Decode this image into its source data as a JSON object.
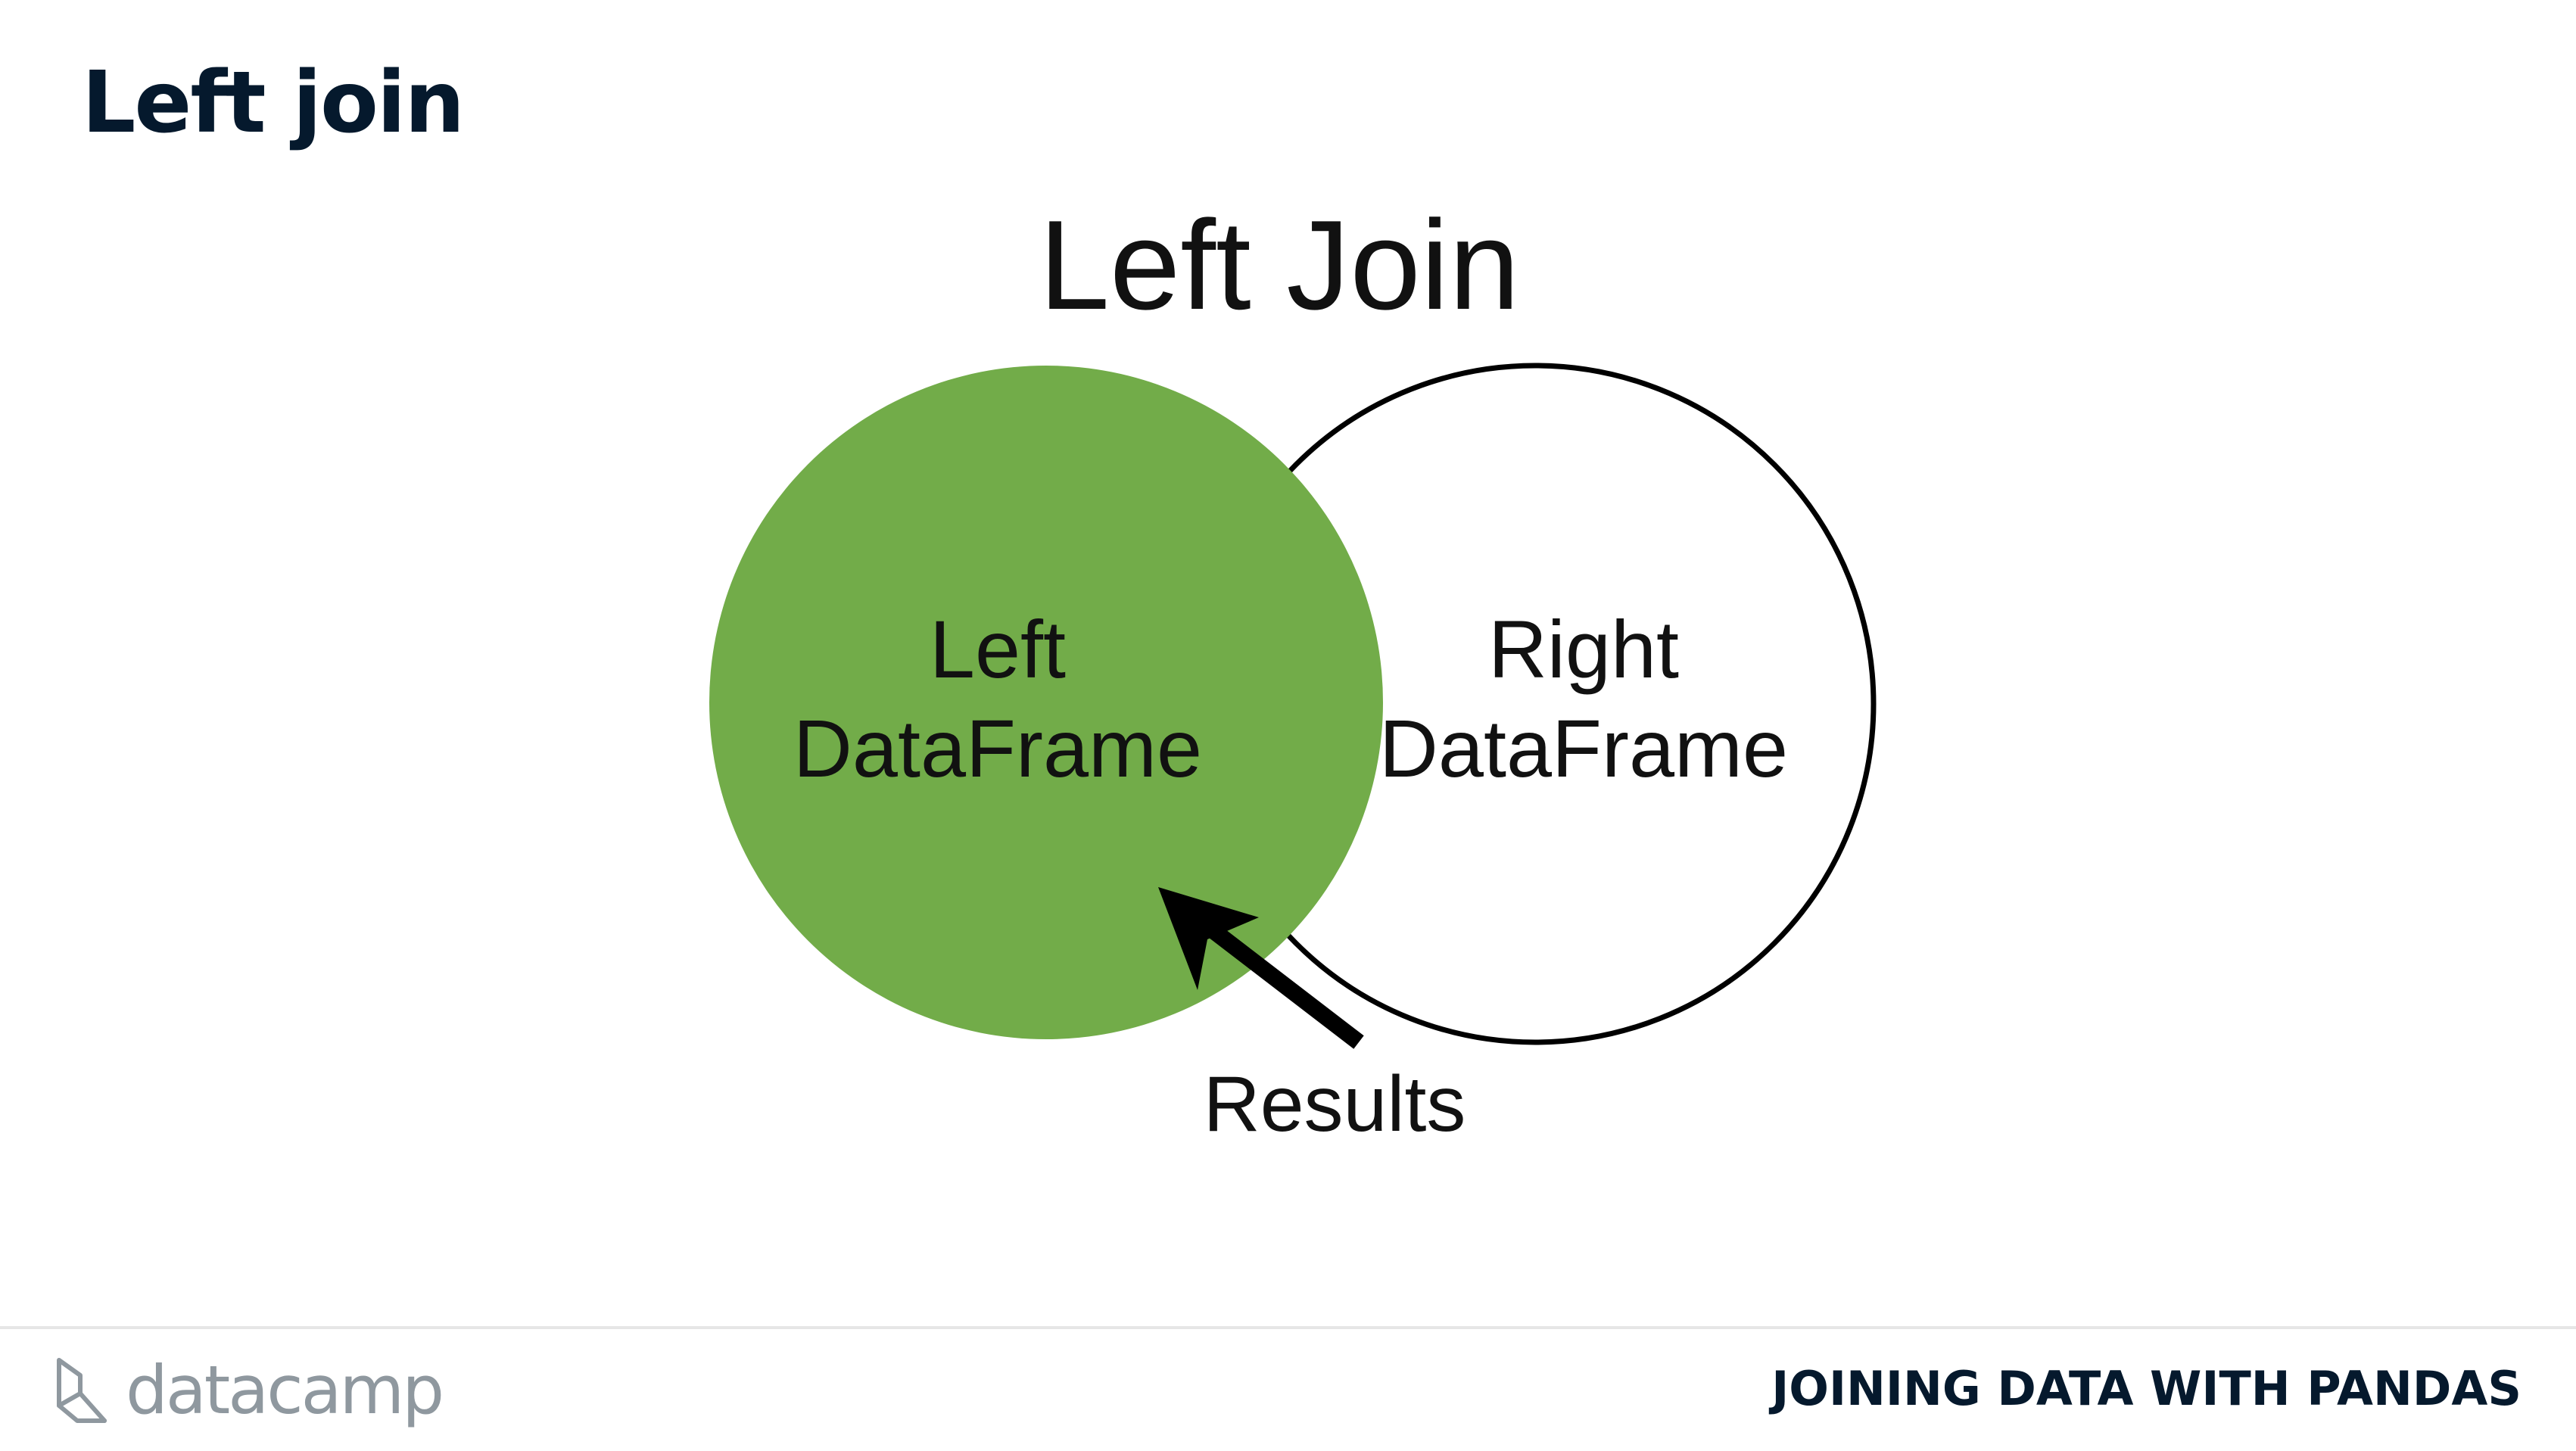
{
  "slide": {
    "title": "Left join"
  },
  "diagram": {
    "title": "Left Join",
    "left_circle": {
      "label_line1": "Left",
      "label_line2": "DataFrame",
      "fill": "#72ac49"
    },
    "right_circle": {
      "label_line1": "Right",
      "label_line2": "DataFrame",
      "fill": "#ffffff"
    },
    "result_label": "Results"
  },
  "footer": {
    "logo_text": "datacamp",
    "logo_icon": "datacamp-logo-icon",
    "course_title": "JOINING DATA WITH PANDAS"
  },
  "colors": {
    "title": "#05192d",
    "left_fill": "#72ac49",
    "outline": "#000000",
    "logo_gray": "#8f989f"
  }
}
